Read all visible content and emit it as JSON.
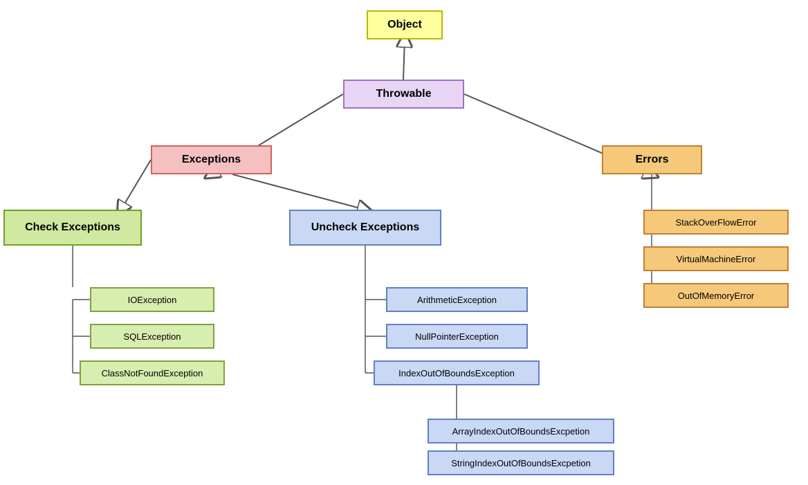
{
  "nodes": {
    "object": {
      "label": "Object"
    },
    "throwable": {
      "label": "Throwable"
    },
    "exceptions": {
      "label": "Exceptions"
    },
    "errors": {
      "label": "Errors"
    },
    "checkExceptions": {
      "label": "Check Exceptions"
    },
    "uncheckExceptions": {
      "label": "Uncheck Exceptions"
    },
    "ioException": {
      "label": "IOException"
    },
    "sqlException": {
      "label": "SQLException"
    },
    "classNotFoundException": {
      "label": "ClassNotFoundException"
    },
    "arithmeticException": {
      "label": "ArithmeticException"
    },
    "nullPointerException": {
      "label": "NullPointerException"
    },
    "indexOutOfBoundsException": {
      "label": "IndexOutOfBoundsException"
    },
    "arrayIndexOutOfBoundsException": {
      "label": "ArrayIndexOutOfBoundsExcpetion"
    },
    "stringIndexOutOfBoundsException": {
      "label": "StringIndexOutOfBoundsExcpetion"
    },
    "stackOverFlowError": {
      "label": "StackOverFlowError"
    },
    "virtualMachineError": {
      "label": "VirtualMachineError"
    },
    "outOfMemoryError": {
      "label": "OutOfMemoryError"
    }
  }
}
